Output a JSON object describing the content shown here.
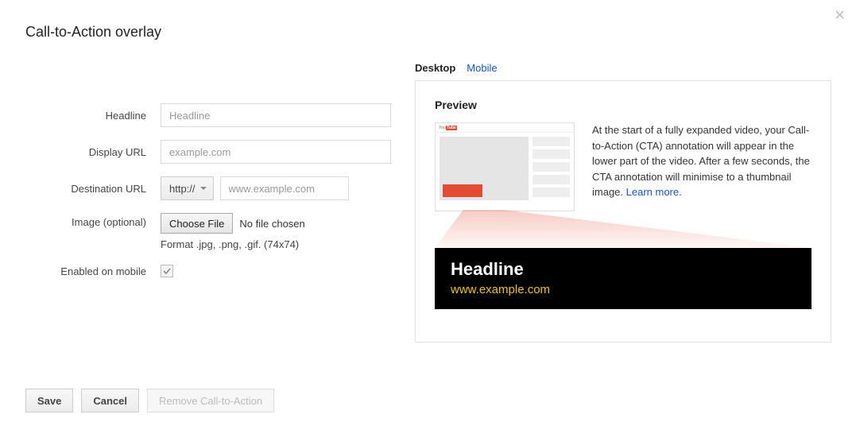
{
  "close_icon": "×",
  "title": "Call-to-Action overlay",
  "form": {
    "headline": {
      "label": "Headline",
      "placeholder": "Headline"
    },
    "display_url": {
      "label": "Display URL",
      "placeholder": "example.com"
    },
    "destination_url": {
      "label": "Destination URL",
      "protocol": "http://",
      "placeholder": "www.example.com"
    },
    "image": {
      "label": "Image (optional)",
      "button": "Choose File",
      "status": "No file chosen",
      "format_note": "Format .jpg, .png, .gif. (74x74)"
    },
    "enabled_mobile": {
      "label": "Enabled on mobile",
      "checked": true
    }
  },
  "buttons": {
    "save": "Save",
    "cancel": "Cancel",
    "remove": "Remove Call-to-Action"
  },
  "preview": {
    "tabs": {
      "desktop": "Desktop",
      "mobile": "Mobile"
    },
    "title": "Preview",
    "description": "At the start of a fully expanded video, your Call-to-Action (CTA) annotation will appear in the lower part of the video. After a few seconds, the CTA annotation will minimise to a thumbnail image. ",
    "learn_more": "Learn more.",
    "overlay": {
      "headline": "Headline",
      "url": "www.example.com"
    },
    "yt_you": "You",
    "yt_tube": "Tube"
  }
}
